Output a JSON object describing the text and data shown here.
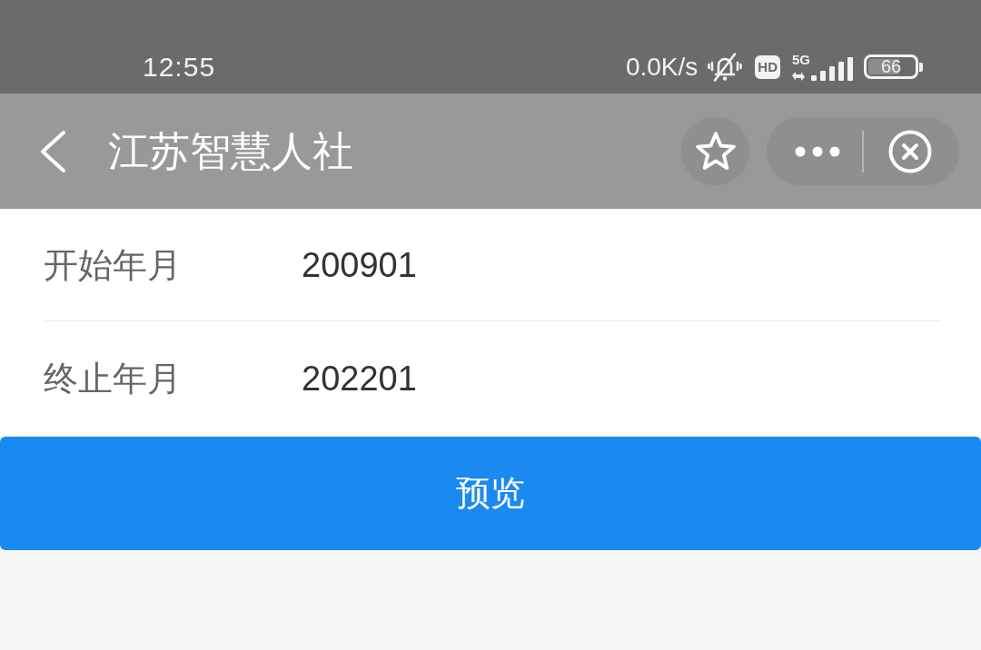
{
  "status_bar": {
    "time": "12:55",
    "network_speed": "0.0K/s",
    "hd_label": "HD",
    "network_type": "5G",
    "battery": "66"
  },
  "nav_bar": {
    "title": "江苏智慧人社"
  },
  "form": {
    "fields": [
      {
        "label": "开始年月",
        "value": "200901"
      },
      {
        "label": "终止年月",
        "value": "202201"
      }
    ]
  },
  "primary_button": {
    "label": "预览"
  }
}
